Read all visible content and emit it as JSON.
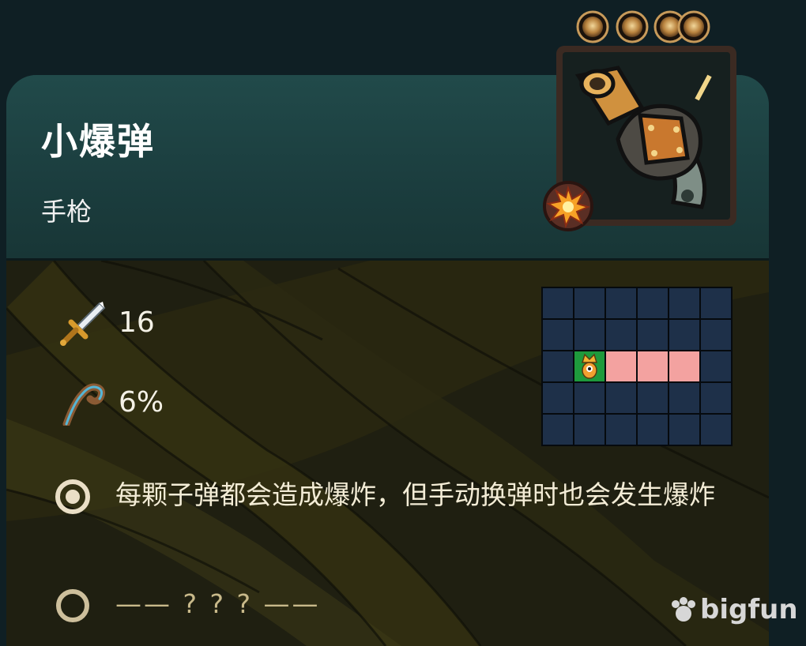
{
  "item": {
    "name": "小爆弹",
    "type": "手枪",
    "damage": "16",
    "crit": "6%",
    "cost_coins": 4
  },
  "effects": [
    {
      "text": "每颗子弹都会造成爆炸，但手动换弹时也会发生爆炸"
    },
    {
      "text": "—— ? ? ? ——"
    }
  ],
  "range_grid": {
    "cols": 6,
    "rows": 5,
    "origin": [
      1,
      2
    ],
    "highlighted": [
      [
        2,
        2
      ],
      [
        3,
        2
      ],
      [
        4,
        2
      ]
    ]
  },
  "icons": {
    "damage": "sword-icon",
    "crit": "crit-hook-icon",
    "item": "pistol-icon",
    "element": "explosion-icon",
    "effect_known": "filled-ring-icon",
    "effect_unknown": "empty-ring-icon"
  },
  "colors": {
    "range_cell": "#f3a2a0",
    "origin_cell": "#1e9a3c",
    "grid_cell": "#1e3049"
  },
  "watermark": {
    "text": "bigfun"
  }
}
